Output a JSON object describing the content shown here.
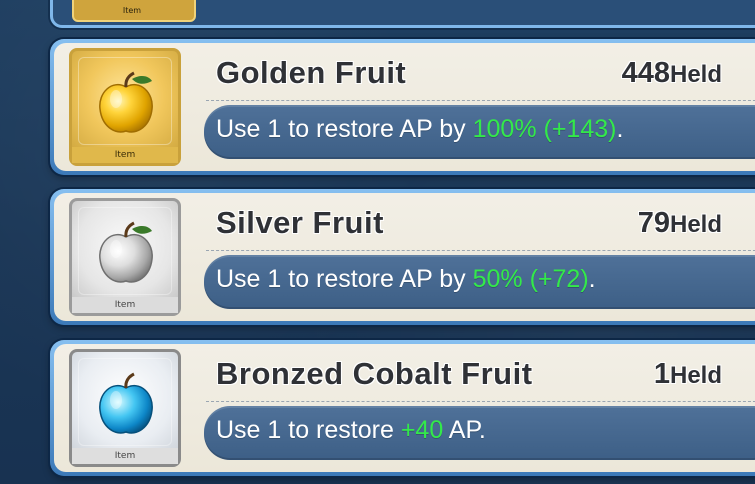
{
  "top_item_label": "Item",
  "items": [
    {
      "name": "Golden Fruit",
      "held_count": "448",
      "held_label": "Held",
      "desc_prefix": "Use 1 to restore AP by ",
      "desc_accent": "100% (+143)",
      "desc_suffix": ".",
      "item_label": "Item"
    },
    {
      "name": "Silver Fruit",
      "held_count": "79",
      "held_label": "Held",
      "desc_prefix": "Use 1 to restore AP by ",
      "desc_accent": "50% (+72)",
      "desc_suffix": ".",
      "item_label": "Item"
    },
    {
      "name": "Bronzed Cobalt Fruit",
      "held_count": "1",
      "held_label": "Held",
      "desc_prefix": "Use 1 to restore ",
      "desc_accent": "+40",
      "desc_suffix": " AP.",
      "item_label": "Item"
    }
  ]
}
